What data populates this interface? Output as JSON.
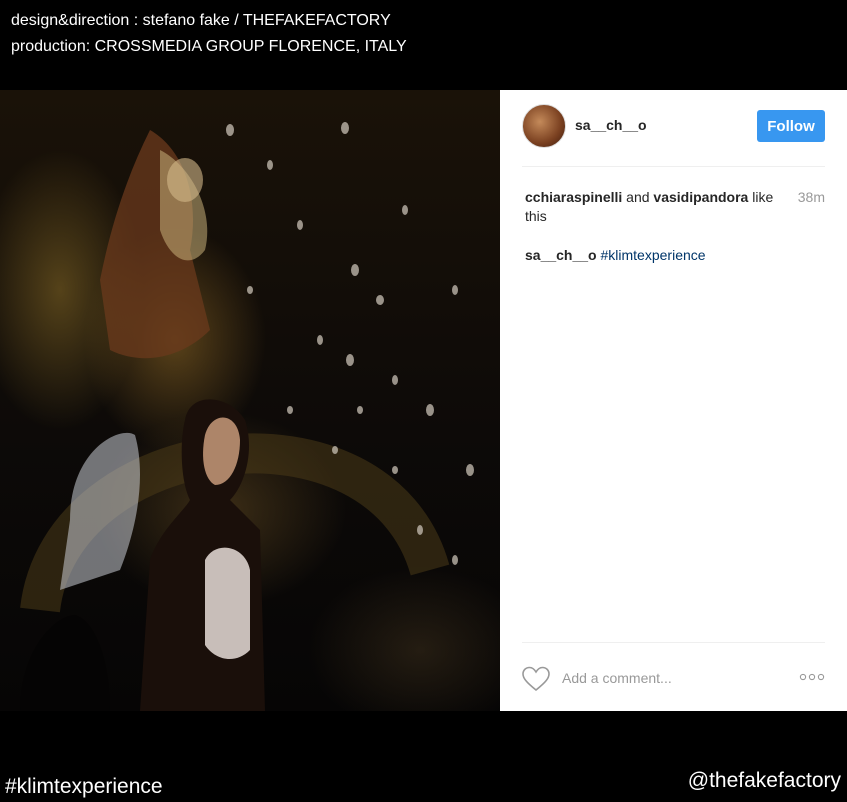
{
  "credits": {
    "line1": "design&direction : stefano fake / THEFAKEFACTORY",
    "line2": "production: CROSSMEDIA GROUP FLORENCE, ITALY"
  },
  "post": {
    "username": "sa__ch__o",
    "follow_label": "Follow",
    "likes": {
      "user1": "cchiaraspinelli",
      "and": " and ",
      "user2": "vasidipandora",
      "suffix": " like this"
    },
    "time": "38m",
    "caption": {
      "username": "sa__ch__o",
      "hashtag": "#klimtexperience"
    },
    "comment_placeholder": "Add a comment..."
  },
  "footer": {
    "hashtag": "#klimtexperience",
    "handle": "@thefakefactory"
  },
  "colors": {
    "follow_bg": "#3897f0",
    "hashtag_link": "#003569",
    "muted_text": "#999999"
  },
  "icons": {
    "like": "heart-outline-icon",
    "more": "ellipsis-icon"
  }
}
